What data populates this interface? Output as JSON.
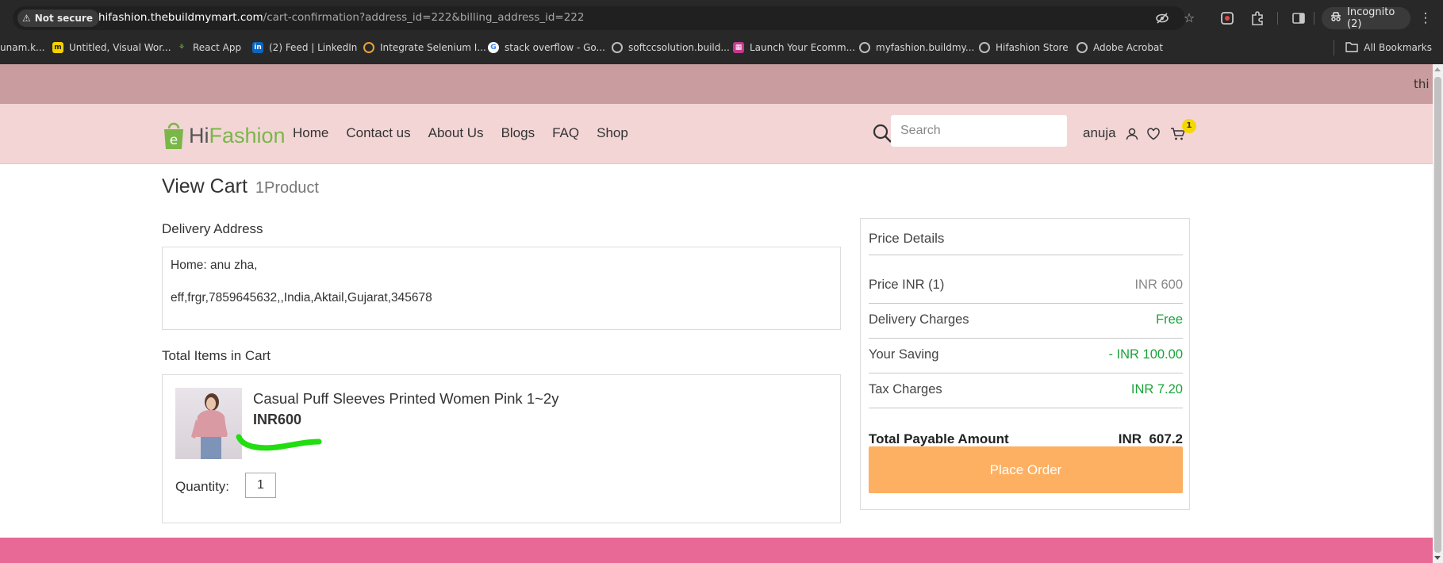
{
  "browser": {
    "security_label": "Not secure",
    "url_host": "hifashion.thebuildmymart.com",
    "url_path": "/cart-confirmation?address_id=222&billing_address_id=222",
    "incognito_label": "Incognito (2)",
    "bookmarks": [
      {
        "label": "unam.k...",
        "icon": "cut-off-favicon"
      },
      {
        "label": "Untitled, Visual Wor...",
        "icon": "miro-icon"
      },
      {
        "label": "React App",
        "icon": "react-app-icon"
      },
      {
        "label": "(2) Feed | LinkedIn",
        "icon": "linkedin-icon"
      },
      {
        "label": "Integrate Selenium I...",
        "icon": "chrome-icon"
      },
      {
        "label": "stack overflow - Go...",
        "icon": "google-icon"
      },
      {
        "label": "softccsolution.build...",
        "icon": "globe-icon"
      },
      {
        "label": "Launch Your Ecomm...",
        "icon": "store-icon"
      },
      {
        "label": "myfashion.buildmy...",
        "icon": "globe-icon"
      },
      {
        "label": "Hifashion Store",
        "icon": "globe-icon"
      },
      {
        "label": "Adobe Acrobat",
        "icon": "globe-icon"
      }
    ],
    "all_bookmarks_label": "All Bookmarks"
  },
  "announcement": {
    "text": "thi"
  },
  "header": {
    "logo_hi": "Hi",
    "logo_fashion": "Fashion",
    "nav": [
      "Home",
      "Contact us",
      "About Us",
      "Blogs",
      "FAQ",
      "Shop"
    ],
    "search_placeholder": "Search",
    "user_name": "anuja",
    "cart_count": "1"
  },
  "cart": {
    "title": "View Cart",
    "product_count": "1Product",
    "delivery_label": "Delivery Address",
    "address_line1": "Home: anu zha,",
    "address_line2": "eff,frgr,7859645632,,India,Aktail,Gujarat,345678",
    "items_label": "Total Items in Cart",
    "item": {
      "name": "Casual Puff Sleeves Printed Women Pink 1~2y",
      "price": "INR600",
      "quantity_label": "Quantity:",
      "quantity": "1"
    }
  },
  "price_details": {
    "title": "Price Details",
    "rows": [
      {
        "label": "Price INR (1)",
        "value": "INR 600"
      },
      {
        "label": "Delivery Charges",
        "value": "Free"
      },
      {
        "label": "Your Saving",
        "value": "- INR 100.00"
      },
      {
        "label": "Tax Charges",
        "value": "INR 7.20"
      }
    ],
    "total_label": "Total Payable Amount",
    "total_value": "INR  607.2",
    "place_order_label": "Place Order"
  },
  "colors": {
    "announcement_bg": "#c99d9f",
    "header_bg": "#f3d5d6",
    "logo_green": "#7ab648",
    "saving_green": "#1aa33a",
    "place_order_bg": "#fdb062",
    "footer_pink": "#e86896",
    "cart_badge": "#f5d800"
  }
}
